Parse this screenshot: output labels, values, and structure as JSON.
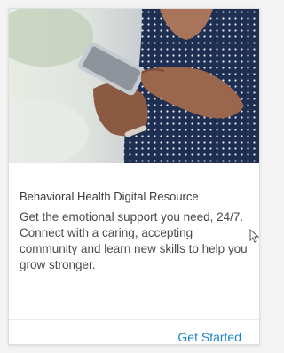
{
  "card": {
    "image": "woman-using-smartphone",
    "title": "Behavioral Health Digital Resource",
    "description": "Get the emotional support you need, 24/7. Connect with a caring, accepting community and learn new skills to help you grow stronger.",
    "cta_label": "Get Started"
  },
  "colors": {
    "link": "#1a84c7",
    "title": "#3a3a3a",
    "body_text": "#4a4a4a"
  },
  "icons": {
    "pointer": "mouse-pointer-icon"
  }
}
